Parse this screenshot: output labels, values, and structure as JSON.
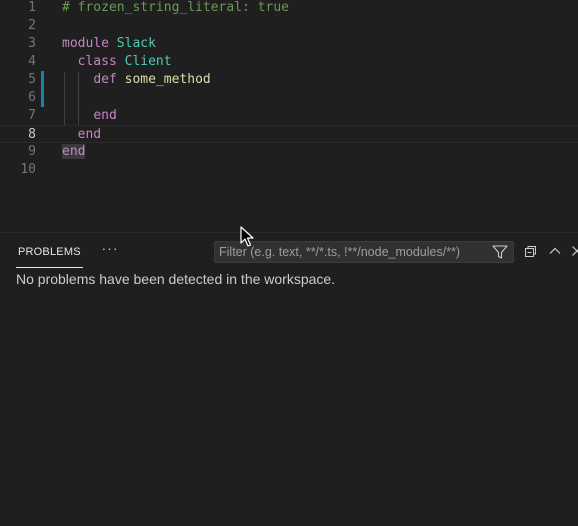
{
  "editor": {
    "lines": [
      {
        "num": "1",
        "tokens": [
          {
            "t": "# frozen_string_literal: true",
            "c": "comment"
          }
        ]
      },
      {
        "num": "2",
        "tokens": []
      },
      {
        "num": "3",
        "tokens": [
          {
            "t": "module",
            "c": "keyword"
          },
          {
            "t": " "
          },
          {
            "t": "Slack",
            "c": "class"
          }
        ]
      },
      {
        "num": "4",
        "tokens": [
          {
            "t": "  "
          },
          {
            "t": "class",
            "c": "keyword"
          },
          {
            "t": " "
          },
          {
            "t": "Client",
            "c": "class"
          }
        ]
      },
      {
        "num": "5",
        "tokens": [
          {
            "t": "    "
          },
          {
            "t": "def",
            "c": "keyword"
          },
          {
            "t": " "
          },
          {
            "t": "some_method",
            "c": "fn"
          }
        ]
      },
      {
        "num": "6",
        "tokens": []
      },
      {
        "num": "7",
        "tokens": [
          {
            "t": "    "
          },
          {
            "t": "end",
            "c": "keyword"
          }
        ]
      },
      {
        "num": "8",
        "tokens": [
          {
            "t": "  "
          },
          {
            "t": "end",
            "c": "keyword"
          }
        ]
      },
      {
        "num": "9",
        "tokens": [
          {
            "t": "end",
            "c": "keyword end-hl"
          }
        ]
      },
      {
        "num": "10",
        "tokens": []
      }
    ],
    "current_line": "8",
    "modified_lines": [
      "5",
      "6"
    ]
  },
  "panel": {
    "tab_label": "PROBLEMS",
    "more_label": "···",
    "filter_placeholder": "Filter (e.g. text, **/*.ts, !**/node_modules/**)",
    "filter_value": "",
    "message": "No problems have been detected in the workspace."
  }
}
